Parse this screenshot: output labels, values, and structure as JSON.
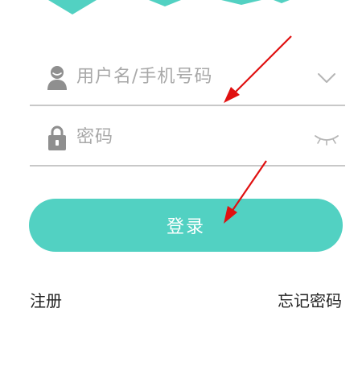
{
  "colors": {
    "accent": "#52d1c2",
    "divider": "#c8c8c8",
    "placeholder": "#a8a8a8",
    "annotation_arrow": "#e01010"
  },
  "login_form": {
    "username": {
      "placeholder": "用户名/手机号码",
      "icon": "user-icon",
      "action_icon": "chevron-down-icon"
    },
    "password": {
      "placeholder": "密码",
      "icon": "lock-icon",
      "action_icon": "eye-closed-icon"
    },
    "submit_label": "登录"
  },
  "links": {
    "register": "注册",
    "forgot_password": "忘记密码"
  }
}
